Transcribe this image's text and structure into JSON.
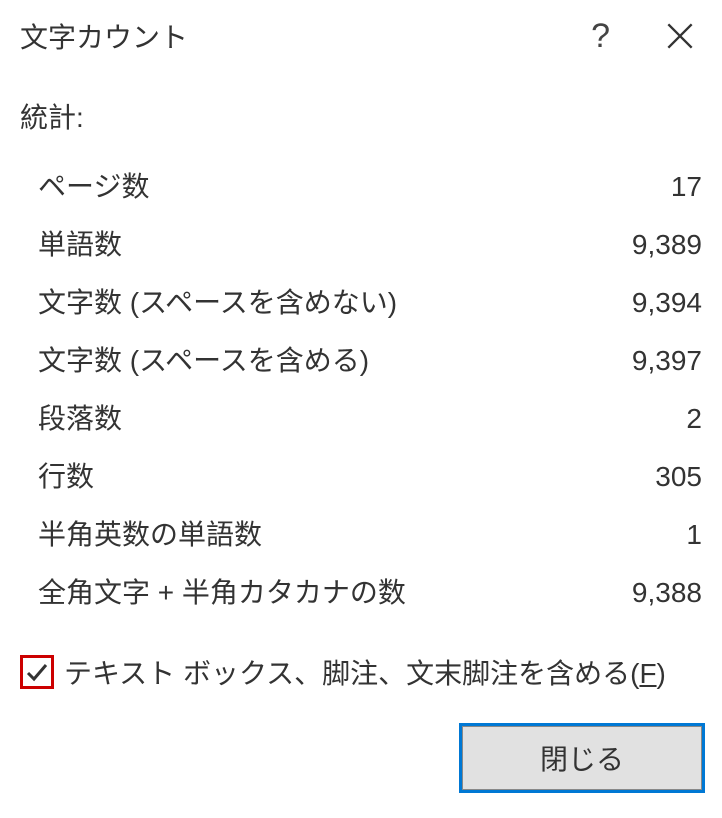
{
  "dialog": {
    "title": "文字カウント",
    "sectionLabel": "統計:",
    "stats": [
      {
        "label": "ページ数",
        "value": "17"
      },
      {
        "label": "単語数",
        "value": "9,389"
      },
      {
        "label": "文字数 (スペースを含めない)",
        "value": "9,394"
      },
      {
        "label": "文字数 (スペースを含める)",
        "value": "9,397"
      },
      {
        "label": "段落数",
        "value": "2"
      },
      {
        "label": "行数",
        "value": "305"
      },
      {
        "label": "半角英数の単語数",
        "value": "1"
      },
      {
        "label": "全角文字 + 半角カタカナの数",
        "value": "9,388"
      }
    ],
    "checkboxLabelPre": "テキスト ボックス、脚注、文末脚注を含める(",
    "checkboxAccel": "F",
    "checkboxLabelPost": ")",
    "checkboxChecked": true,
    "closeButtonLabel": "閉じる"
  }
}
